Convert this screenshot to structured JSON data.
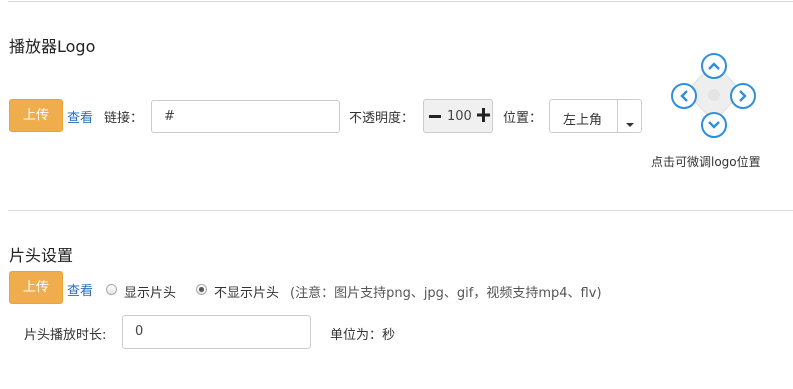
{
  "logo": {
    "title": "播放器Logo",
    "upload_label": "上传",
    "view_label": "查看",
    "link_label": "链接：",
    "link_value": "#",
    "opacity_label": "不透明度：",
    "opacity_value": "100",
    "position_label": "位置：",
    "position_value": "左上角",
    "adjust_hint": "点击可微调logo位置",
    "icons": [
      "minus-icon",
      "plus-icon",
      "caret-down-icon",
      "arrow-up-icon",
      "arrow-left-icon",
      "arrow-right-icon",
      "arrow-down-icon"
    ]
  },
  "intro": {
    "title": "片头设置",
    "upload_label": "上传",
    "view_label": "查看",
    "show_label": "显示片头",
    "hide_label": "不显示片头",
    "selected": "hide",
    "note": "(注意：图片支持png、jpg、gif，视频支持mp4、flv)",
    "duration_label": "片头播放时长:",
    "duration_value": "0",
    "unit_label": "单位为：秒"
  },
  "colors": {
    "accent": "#f0ad4e",
    "link": "#2a6ebb",
    "arrow": "#2f8fdf"
  }
}
